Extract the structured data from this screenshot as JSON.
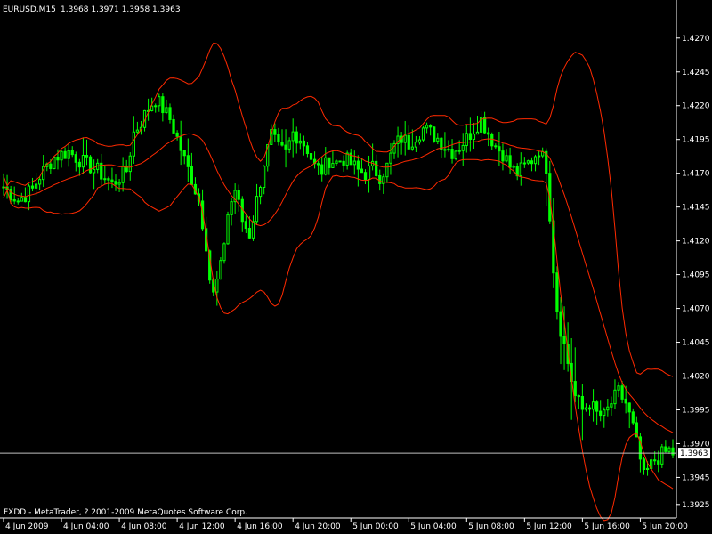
{
  "header": {
    "symbol_label": "EURUSD,M15",
    "ohlc_label": "1.3968 1.3971 1.3958 1.3963"
  },
  "footer": {
    "copyright": "FXDD - MetaTrader, ? 2001-2009 MetaQuotes Software Corp."
  },
  "colors": {
    "background": "#000000",
    "candle": "#00ff00",
    "bands": "#ff2a00",
    "axis": "#ffffff",
    "price_line": "#c0c0c0",
    "price_label_bg": "#ffffff",
    "price_label_fg": "#000000"
  },
  "chart_data": {
    "type": "candlestick",
    "instrument": "EURUSD",
    "timeframe": "M15",
    "indicator": "Bollinger Bands",
    "grid": false,
    "ylim": [
      1.3915,
      1.4285
    ],
    "xlim": [
      "4 Jun 2009 00:00",
      "5 Jun 2009 23:45"
    ],
    "y_ticks": [
      "1.4270",
      "1.4245",
      "1.4220",
      "1.4195",
      "1.4170",
      "1.4145",
      "1.4120",
      "1.4095",
      "1.4070",
      "1.4045",
      "1.4020",
      "1.3995",
      "1.3970",
      "1.3945",
      "1.3925"
    ],
    "x_ticks": [
      {
        "label": "4 Jun 2009",
        "t": 0
      },
      {
        "label": "4 Jun 04:00",
        "t": 16
      },
      {
        "label": "4 Jun 08:00",
        "t": 32
      },
      {
        "label": "4 Jun 12:00",
        "t": 48
      },
      {
        "label": "4 Jun 16:00",
        "t": 64
      },
      {
        "label": "4 Jun 20:00",
        "t": 80
      },
      {
        "label": "5 Jun 00:00",
        "t": 96
      },
      {
        "label": "5 Jun 04:00",
        "t": 112
      },
      {
        "label": "5 Jun 08:00",
        "t": 128
      },
      {
        "label": "5 Jun 12:00",
        "t": 144
      },
      {
        "label": "5 Jun 16:00",
        "t": 160
      },
      {
        "label": "5 Jun 20:00",
        "t": 176
      }
    ],
    "current_price": 1.3963,
    "current_price_label": "1.3963",
    "close_path": [
      [
        0,
        1.416
      ],
      [
        4,
        1.415
      ],
      [
        8,
        1.4158
      ],
      [
        10,
        1.4168
      ],
      [
        14,
        1.4182
      ],
      [
        18,
        1.4186
      ],
      [
        22,
        1.4178
      ],
      [
        26,
        1.4172
      ],
      [
        30,
        1.4162
      ],
      [
        34,
        1.4172
      ],
      [
        36,
        1.42
      ],
      [
        38,
        1.4208
      ],
      [
        40,
        1.4218
      ],
      [
        42,
        1.4225
      ],
      [
        44,
        1.4218
      ],
      [
        46,
        1.421
      ],
      [
        48,
        1.4196
      ],
      [
        50,
        1.418
      ],
      [
        52,
        1.4166
      ],
      [
        54,
        1.415
      ],
      [
        56,
        1.4118
      ],
      [
        57,
        1.4092
      ],
      [
        58,
        1.408
      ],
      [
        60,
        1.41
      ],
      [
        62,
        1.414
      ],
      [
        64,
        1.4158
      ],
      [
        66,
        1.4135
      ],
      [
        68,
        1.4125
      ],
      [
        70,
        1.415
      ],
      [
        72,
        1.4178
      ],
      [
        74,
        1.4198
      ],
      [
        76,
        1.4188
      ],
      [
        78,
        1.4185
      ],
      [
        80,
        1.42
      ],
      [
        82,
        1.4196
      ],
      [
        84,
        1.4188
      ],
      [
        86,
        1.4175
      ],
      [
        88,
        1.4172
      ],
      [
        90,
        1.418
      ],
      [
        92,
        1.4178
      ],
      [
        94,
        1.4181
      ],
      [
        96,
        1.4177
      ],
      [
        98,
        1.4172
      ],
      [
        100,
        1.417
      ],
      [
        102,
        1.4174
      ],
      [
        104,
        1.4168
      ],
      [
        106,
        1.4175
      ],
      [
        108,
        1.419
      ],
      [
        110,
        1.4196
      ],
      [
        112,
        1.4192
      ],
      [
        114,
        1.4198
      ],
      [
        116,
        1.4203
      ],
      [
        118,
        1.42
      ],
      [
        120,
        1.4196
      ],
      [
        122,
        1.419
      ],
      [
        124,
        1.4186
      ],
      [
        126,
        1.419
      ],
      [
        128,
        1.4196
      ],
      [
        130,
        1.4203
      ],
      [
        132,
        1.421
      ],
      [
        134,
        1.42
      ],
      [
        136,
        1.419
      ],
      [
        138,
        1.4185
      ],
      [
        140,
        1.4175
      ],
      [
        142,
        1.417
      ],
      [
        144,
        1.4175
      ],
      [
        146,
        1.418
      ],
      [
        148,
        1.4188
      ],
      [
        150,
        1.4175
      ],
      [
        151,
        1.414
      ],
      [
        152,
        1.41
      ],
      [
        153,
        1.407
      ],
      [
        154,
        1.4055
      ],
      [
        156,
        1.403
      ],
      [
        158,
        1.4005
      ],
      [
        160,
        1.3995
      ],
      [
        162,
        1.4
      ],
      [
        164,
        1.3992
      ],
      [
        166,
        1.399
      ],
      [
        168,
        1.4
      ],
      [
        170,
        1.4008
      ],
      [
        172,
        1.4
      ],
      [
        174,
        1.3982
      ],
      [
        175,
        1.397
      ],
      [
        176,
        1.3958
      ],
      [
        177,
        1.3945
      ],
      [
        178,
        1.395
      ],
      [
        180,
        1.3958
      ],
      [
        182,
        1.3962
      ],
      [
        184,
        1.3965
      ],
      [
        185,
        1.3963
      ]
    ]
  }
}
